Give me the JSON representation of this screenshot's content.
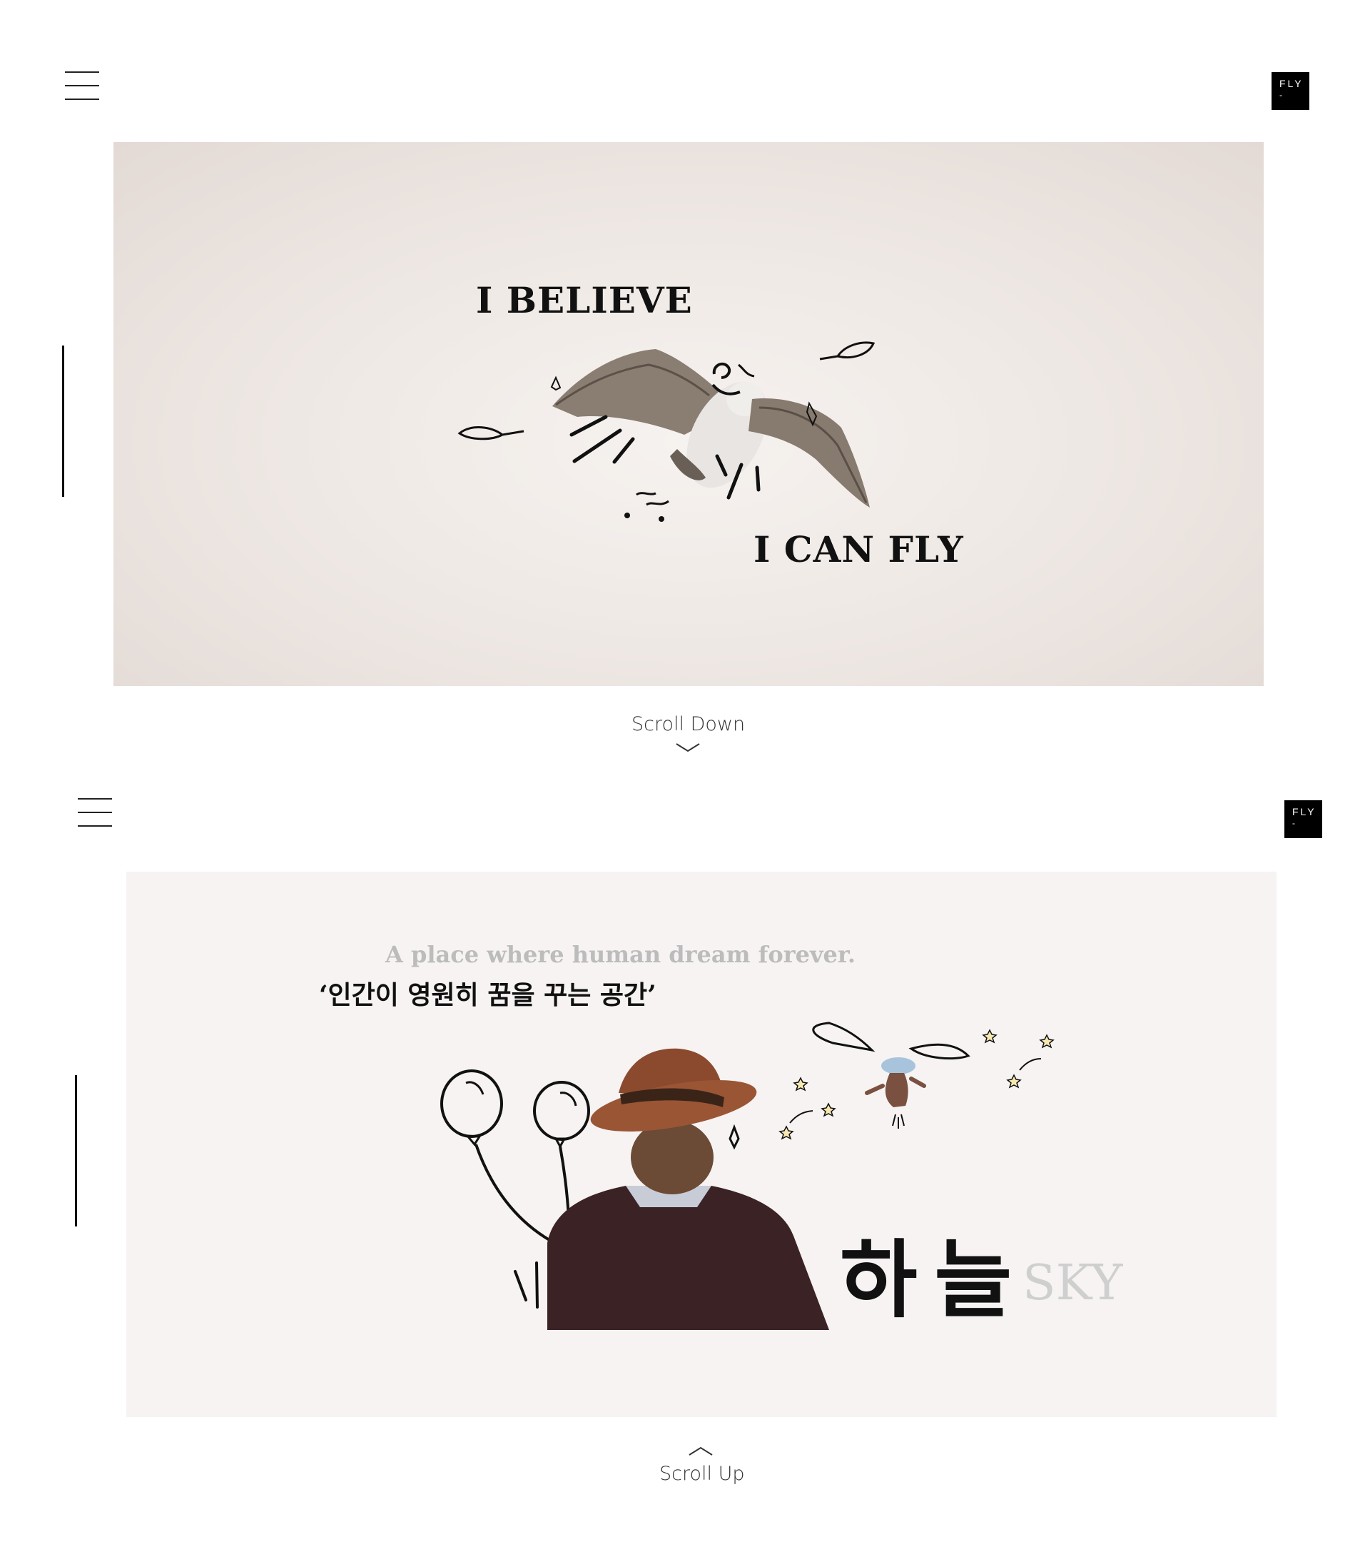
{
  "badge": {
    "label": "FLY",
    "sub": "-"
  },
  "hero": {
    "line1": "I BELIEVE",
    "line2": "I CAN FLY",
    "scroll_label": "Scroll Down"
  },
  "sky_section": {
    "tagline_en": "A place where human dream forever.",
    "tagline_ko": "‘인간이 영원히 꿈을 꾸는 공간’",
    "title_ko": "하늘",
    "title_en": "SKY",
    "scroll_label": "Scroll Up"
  },
  "icons": {
    "menu": "hamburger-menu-icon",
    "scroll_down": "chevron-down-icon",
    "scroll_up": "chevron-up-icon"
  },
  "colors": {
    "badge_bg": "#000000",
    "panel_hero": "#efe9e5",
    "panel_sky": "#f6f3f2",
    "muted_text": "#bcbcbc"
  }
}
